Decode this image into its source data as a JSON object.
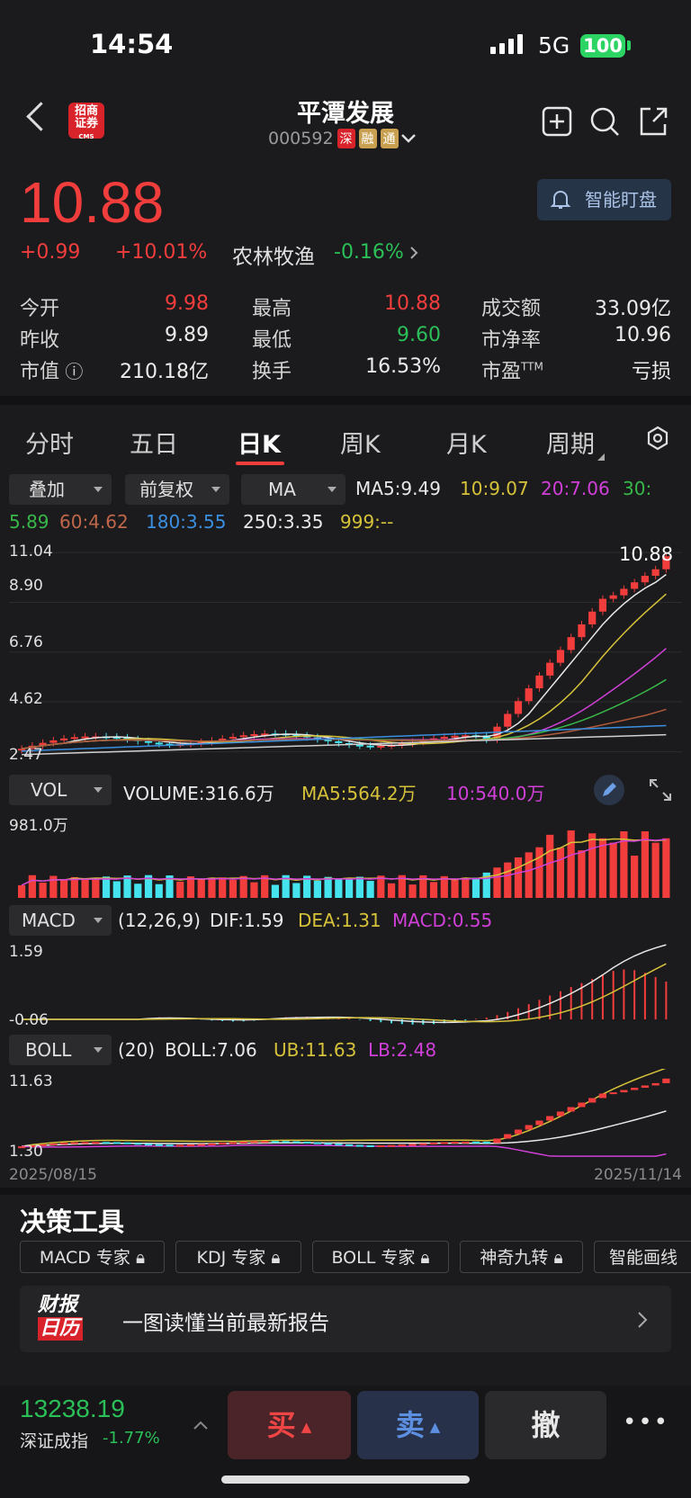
{
  "status_bar": {
    "time": "14:54",
    "network": "5G",
    "battery": "100"
  },
  "header": {
    "stock_name": "平潭发展",
    "stock_code": "000592",
    "tags": [
      "深",
      "融",
      "通"
    ],
    "broker_logo_line1": "招商",
    "broker_logo_line2": "证券",
    "broker_logo_line3": "CMS"
  },
  "quote": {
    "price": "10.88",
    "change": "+0.99",
    "change_pct": "+10.01%",
    "sector_name": "农林牧渔",
    "sector_change": "-0.16%",
    "alert_button": "智能盯盘"
  },
  "stats": [
    {
      "label": "今开",
      "value": "9.98",
      "color": "red"
    },
    {
      "label": "最高",
      "value": "10.88",
      "color": "red"
    },
    {
      "label": "成交额",
      "value": "33.09亿",
      "color": "white"
    },
    {
      "label": "昨收",
      "value": "9.89",
      "color": "white"
    },
    {
      "label": "最低",
      "value": "9.60",
      "color": "green"
    },
    {
      "label": "市净率",
      "value": "10.96",
      "color": "white"
    },
    {
      "label": "市值",
      "value": "210.18亿",
      "color": "white"
    },
    {
      "label": "换手",
      "value": "16.53%",
      "color": "white"
    },
    {
      "label": "市盈",
      "label_sup": "TTM",
      "value": "亏损",
      "color": "white"
    }
  ],
  "tabs": [
    "分时",
    "五日",
    "日K",
    "周K",
    "月K",
    "周期"
  ],
  "active_tab": "日K",
  "controls": {
    "overlay": "叠加",
    "adjust": "前复权",
    "indicator": "MA"
  },
  "ma": {
    "ma5": "MA5:9.49",
    "ma10": "10:9.07",
    "ma20": "20:7.06",
    "ma30_a": "30:",
    "ma30_b": "5.89",
    "ma60": "60:4.62",
    "ma180": "180:3.55",
    "ma250": "250:3.35",
    "ma999": "999:--"
  },
  "colors": {
    "up": "#f23d3d",
    "down": "#44e3ee",
    "ma5": "#e8e8e8",
    "ma10": "#d6c23a",
    "ma20": "#d040d8",
    "ma30": "#38b848",
    "ma60": "#b05a3c",
    "ma180": "#3b8fe0",
    "ma250": "#d0d0d0"
  },
  "kline_axis": {
    "y1": "11.04",
    "y2": "8.90",
    "y3": "6.76",
    "y4": "4.62",
    "y5": "2.47",
    "last_price": "10.88"
  },
  "vol": {
    "dropdown": "VOL",
    "volume": "VOLUME:316.6万",
    "ma5": "MA5:564.2万",
    "ma10": "10:540.0万",
    "axis_max": "981.0万"
  },
  "macd": {
    "dropdown": "MACD",
    "params": "(12,26,9)",
    "dif": "DIF:1.59",
    "dea": "DEA:1.31",
    "macd": "MACD:0.55",
    "axis_top": "1.59",
    "axis_bottom": "-0.06"
  },
  "boll": {
    "dropdown": "BOLL",
    "params": "(20)",
    "boll": "BOLL:7.06",
    "ub": "UB:11.63",
    "lb": "LB:2.48",
    "axis_top": "11.63",
    "axis_bottom": "1.30"
  },
  "dates": {
    "start": "2025/08/15",
    "end": "2025/11/14"
  },
  "decision": {
    "title": "决策工具",
    "tools": [
      "MACD 专家",
      "KDJ 专家",
      "BOLL 专家",
      "神奇九转",
      "智能画线"
    ]
  },
  "report": {
    "logo_line1": "财报",
    "logo_line2": "日历",
    "text": "一图读懂当前最新报告"
  },
  "bottom": {
    "index_value": "13238.19",
    "index_name": "深证成指",
    "index_change": "-1.77%",
    "buy": "买",
    "sell": "卖",
    "cancel": "撤",
    "more": "•••"
  }
}
